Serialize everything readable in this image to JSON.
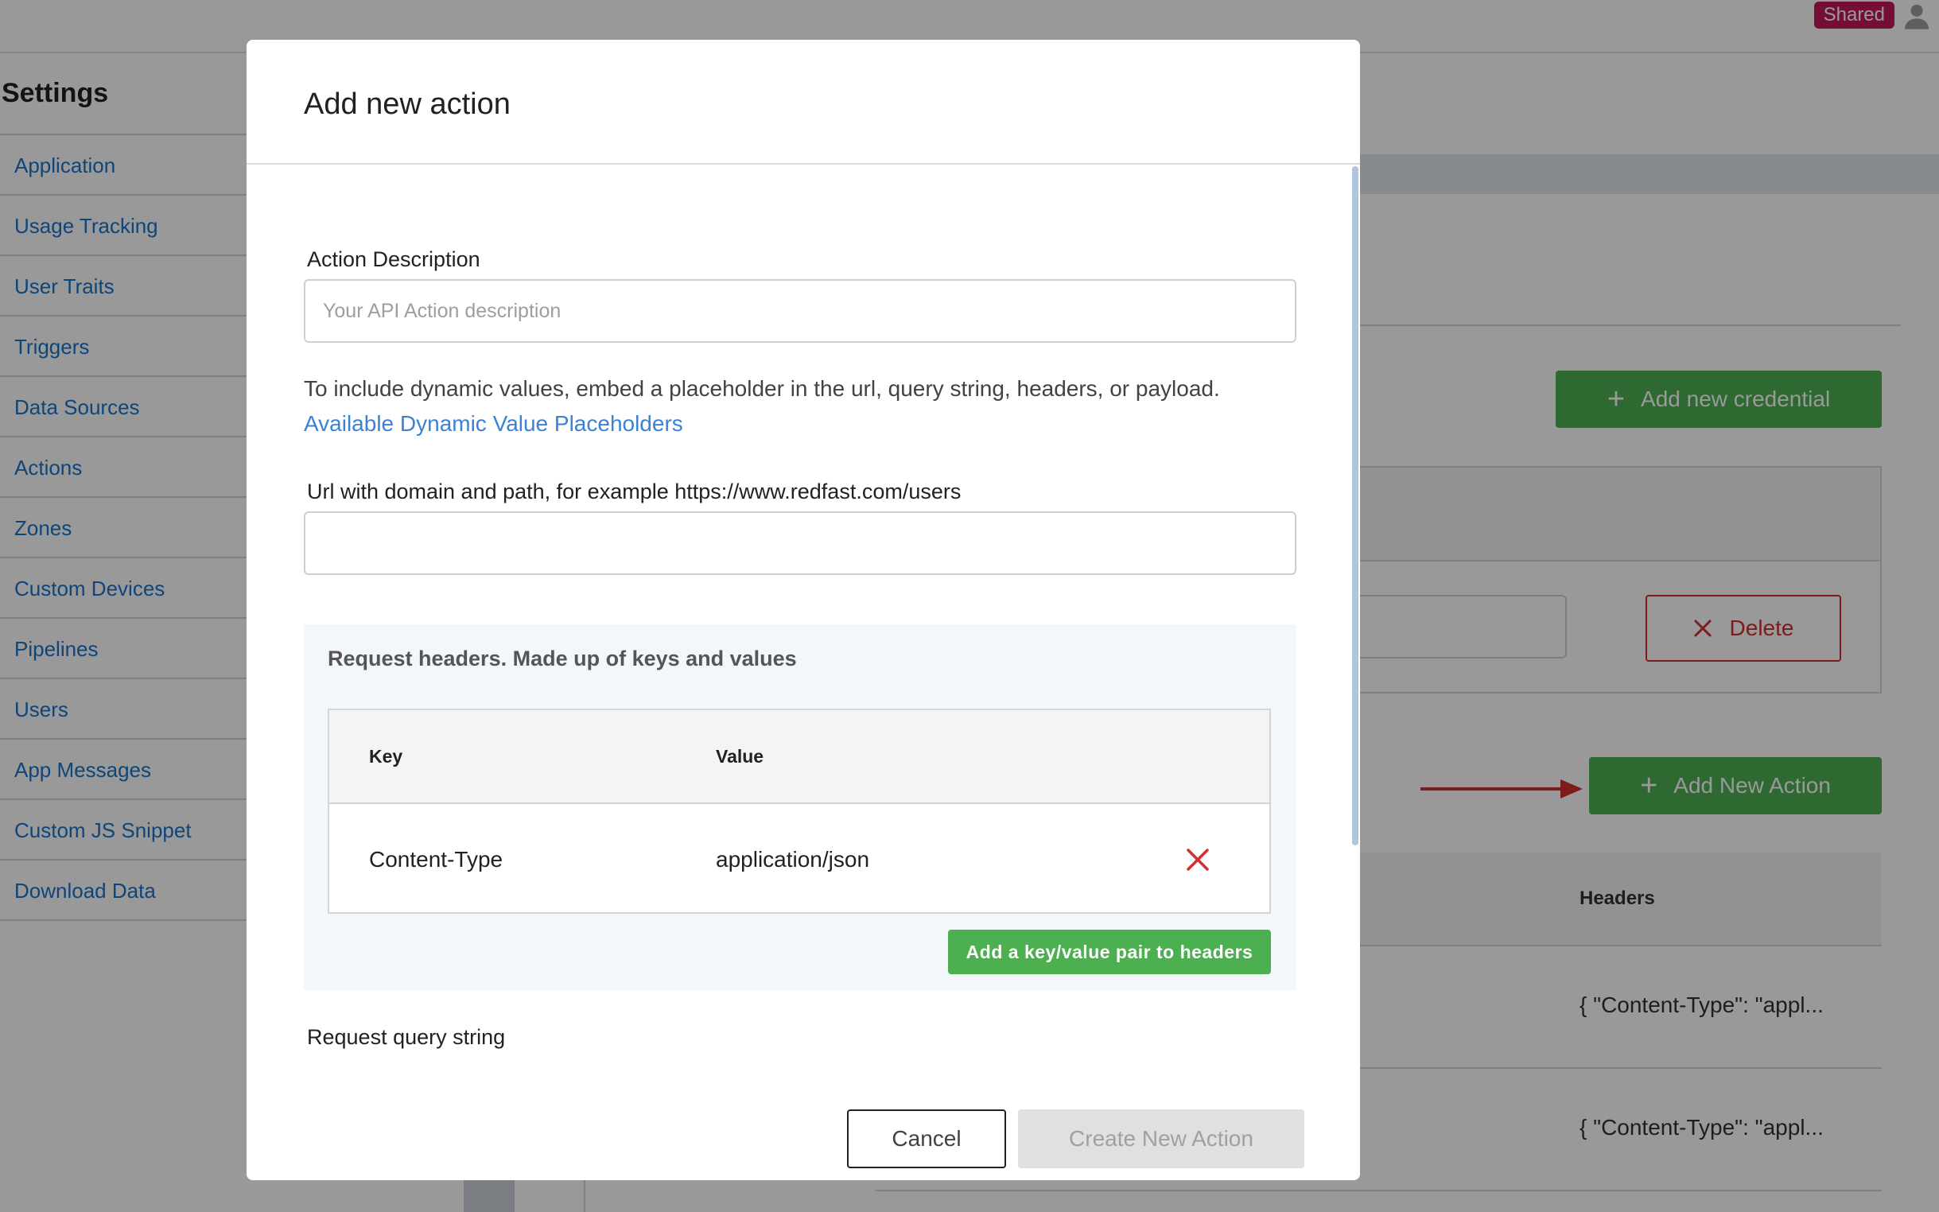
{
  "topbar": {
    "badge": "Shared",
    "user_icon": "user-icon"
  },
  "settings": {
    "title": "Settings",
    "items": [
      {
        "label": "Application"
      },
      {
        "label": "Usage Tracking"
      },
      {
        "label": "User Traits"
      },
      {
        "label": "Triggers"
      },
      {
        "label": "Data Sources"
      },
      {
        "label": "Actions"
      },
      {
        "label": "Zones"
      },
      {
        "label": "Custom Devices"
      },
      {
        "label": "Pipelines"
      },
      {
        "label": "Users"
      },
      {
        "label": "App Messages"
      },
      {
        "label": "Custom JS Snippet"
      },
      {
        "label": "Download Data"
      }
    ]
  },
  "background": {
    "add_credential_label": "Add new credential",
    "delete_label": "Delete",
    "add_action_label": "Add New Action",
    "table_header": "Headers",
    "rows": [
      {
        "headers": "{ \"Content-Type\": \"appl..."
      },
      {
        "headers": "{ \"Content-Type\": \"appl..."
      }
    ]
  },
  "modal": {
    "title": "Add new action",
    "description_label": "Action Description",
    "description_placeholder": "Your API Action description",
    "description_value": "",
    "hint": "To include dynamic values, embed a placeholder in the url, query string, headers, or payload.",
    "hint_link": "Available Dynamic Value Placeholders",
    "url_label": "Url with domain and path, for example https://www.redfast.com/users",
    "url_value": "",
    "headers": {
      "title": "Request headers. Made up of keys and values",
      "key_header": "Key",
      "value_header": "Value",
      "rows": [
        {
          "key": "Content-Type",
          "value": "application/json"
        }
      ],
      "add_label": "Add a key/value pair to headers"
    },
    "query_label": "Request query string",
    "query_value": "",
    "cancel_label": "Cancel",
    "create_label": "Create New Action"
  },
  "colors": {
    "accent_green": "#4caf50",
    "danger_red": "#d32f2f",
    "link_blue": "#3b82d6",
    "badge_pink": "#c2185b"
  }
}
